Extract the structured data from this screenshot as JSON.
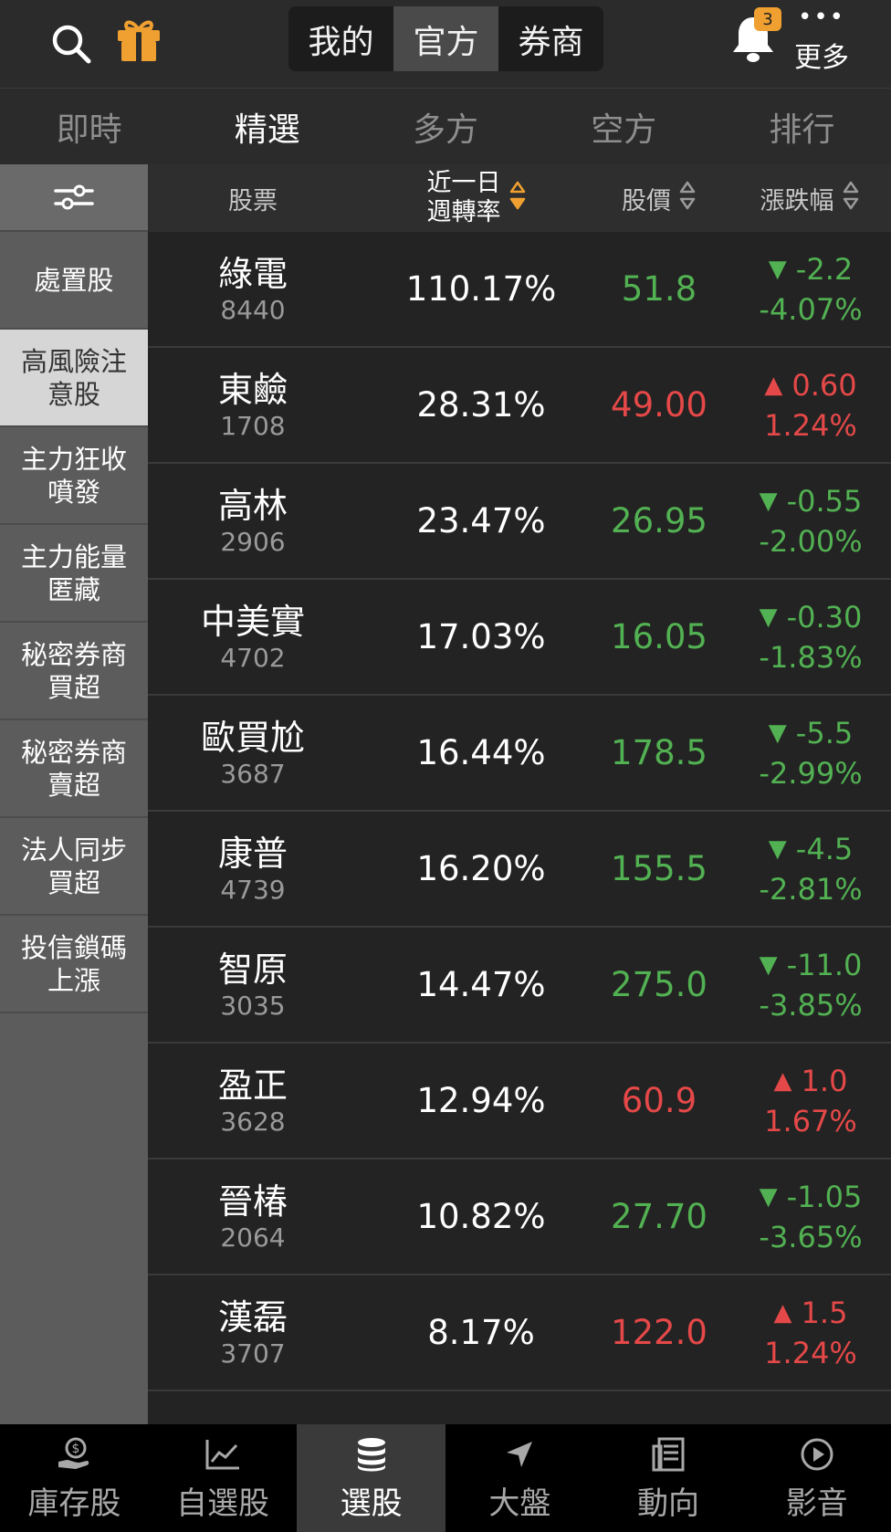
{
  "header": {
    "segments": [
      {
        "label": "我的",
        "active": false
      },
      {
        "label": "官方",
        "active": true
      },
      {
        "label": "券商",
        "active": false
      }
    ],
    "notification_count": "3",
    "more_label": "更多"
  },
  "category_tabs": [
    {
      "label": "即時",
      "active": false
    },
    {
      "label": "精選",
      "active": true
    },
    {
      "label": "多方",
      "active": false
    },
    {
      "label": "空方",
      "active": false
    },
    {
      "label": "排行",
      "active": false
    }
  ],
  "sidebar": {
    "items": [
      {
        "label": "處置股",
        "active": false
      },
      {
        "label": "高風險注意股",
        "active": true
      },
      {
        "label": "主力狂收噴發",
        "active": false
      },
      {
        "label": "主力能量匿藏",
        "active": false
      },
      {
        "label": "秘密券商買超",
        "active": false
      },
      {
        "label": "秘密券商賣超",
        "active": false
      },
      {
        "label": "法人同步買超",
        "active": false
      },
      {
        "label": "投信鎖碼上漲",
        "active": false
      }
    ]
  },
  "table": {
    "headers": {
      "stock": "股票",
      "turnover_line1": "近一日",
      "turnover_line2": "週轉率",
      "price": "股價",
      "change": "漲跌幅"
    },
    "rows": [
      {
        "name": "綠電",
        "code": "8440",
        "turnover": "110.17%",
        "price": "51.8",
        "change": "-2.2",
        "pct": "-4.07%",
        "dir": "down"
      },
      {
        "name": "東鹼",
        "code": "1708",
        "turnover": "28.31%",
        "price": "49.00",
        "change": "0.60",
        "pct": "1.24%",
        "dir": "up"
      },
      {
        "name": "高林",
        "code": "2906",
        "turnover": "23.47%",
        "price": "26.95",
        "change": "-0.55",
        "pct": "-2.00%",
        "dir": "down"
      },
      {
        "name": "中美實",
        "code": "4702",
        "turnover": "17.03%",
        "price": "16.05",
        "change": "-0.30",
        "pct": "-1.83%",
        "dir": "down"
      },
      {
        "name": "歐買尬",
        "code": "3687",
        "turnover": "16.44%",
        "price": "178.5",
        "change": "-5.5",
        "pct": "-2.99%",
        "dir": "down"
      },
      {
        "name": "康普",
        "code": "4739",
        "turnover": "16.20%",
        "price": "155.5",
        "change": "-4.5",
        "pct": "-2.81%",
        "dir": "down"
      },
      {
        "name": "智原",
        "code": "3035",
        "turnover": "14.47%",
        "price": "275.0",
        "change": "-11.0",
        "pct": "-3.85%",
        "dir": "down"
      },
      {
        "name": "盈正",
        "code": "3628",
        "turnover": "12.94%",
        "price": "60.9",
        "change": "1.0",
        "pct": "1.67%",
        "dir": "up"
      },
      {
        "name": "晉椿",
        "code": "2064",
        "turnover": "10.82%",
        "price": "27.70",
        "change": "-1.05",
        "pct": "-3.65%",
        "dir": "down"
      },
      {
        "name": "漢磊",
        "code": "3707",
        "turnover": "8.17%",
        "price": "122.0",
        "change": "1.5",
        "pct": "1.24%",
        "dir": "up"
      }
    ]
  },
  "bottom_nav": [
    {
      "label": "庫存股",
      "icon": "money-hand-icon",
      "active": false
    },
    {
      "label": "自選股",
      "icon": "line-chart-icon",
      "active": false
    },
    {
      "label": "選股",
      "icon": "coin-stack-icon",
      "active": true
    },
    {
      "label": "大盤",
      "icon": "navigation-arrow-icon",
      "active": false
    },
    {
      "label": "動向",
      "icon": "newspaper-icon",
      "active": false
    },
    {
      "label": "影音",
      "icon": "play-circle-icon",
      "active": false
    }
  ],
  "colors": {
    "up": "#e54848",
    "down": "#52b152",
    "accent": "#f0a030"
  }
}
